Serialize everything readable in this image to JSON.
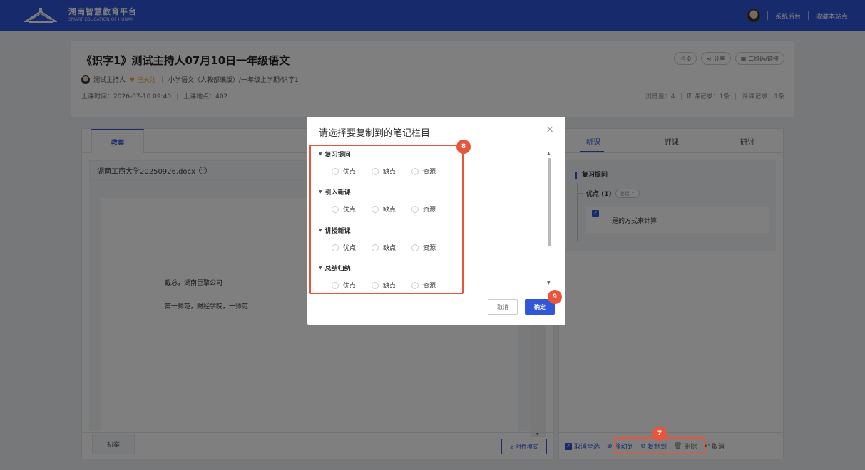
{
  "colors": {
    "brand": "#2f57d8",
    "highlight": "#e8553a",
    "follow": "#f0a23b"
  },
  "header": {
    "logo_cn": "湖南智慧教育平台",
    "logo_en": "SMART EDUCATION OF HUNAN",
    "admin_link": "系统后台",
    "bookmark_link": "收藏本站点"
  },
  "course": {
    "title": "《识字1》测试主持人07月10日一年级语文",
    "host": "测试主持人",
    "follow": "已关注",
    "subject_path": "小学语文（人教部编版）/一年级上学期/识字1",
    "time": "上课时间：2026-07-10 09:40",
    "place": "上课地点：402",
    "like": "0",
    "share": "分享",
    "qrcode": "二维码/链接",
    "views": "浏览量：4",
    "listen_records": "听课记录：1条",
    "eval_records": "评课记录：1条"
  },
  "left": {
    "tab": "教案",
    "file_name": "湖南工商大学20250926.docx",
    "doc_lines": [
      "戴总，湖南巨擎公司",
      "第一师范，财经学院，一师范"
    ],
    "foot_tab": "初案",
    "attach_mode": "附件模式"
  },
  "right": {
    "tabs": [
      "听课",
      "评课",
      "研讨"
    ],
    "section": "复习提问",
    "subsection": "优点 (1)",
    "collapse": "收起",
    "note": "是的方式来计算",
    "footer": {
      "deselect_all": "取消全选",
      "move_to": "移动到",
      "copy_to": "复制到",
      "delete": "删除",
      "cancel": "取消"
    }
  },
  "modal": {
    "title": "请选择要复制到的笔记栏目",
    "categories": [
      {
        "name": "复习提问",
        "options": [
          "优点",
          "缺点",
          "资源"
        ]
      },
      {
        "name": "引入新课",
        "options": [
          "优点",
          "缺点",
          "资源"
        ]
      },
      {
        "name": "讲授新课",
        "options": [
          "优点",
          "缺点",
          "资源"
        ]
      },
      {
        "name": "总结归纳",
        "options": [
          "优点",
          "缺点",
          "资源"
        ]
      }
    ],
    "cancel": "取消",
    "confirm": "确定"
  },
  "badges": [
    "7",
    "8",
    "9"
  ]
}
